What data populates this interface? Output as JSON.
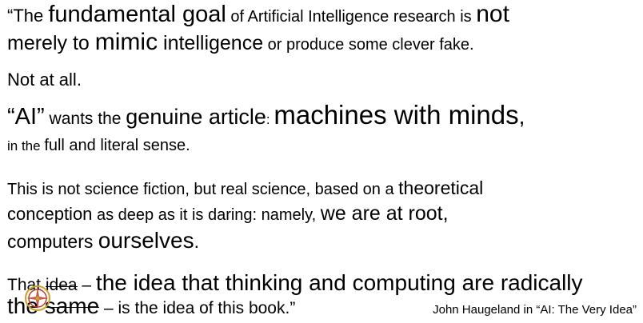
{
  "quote": {
    "l1": {
      "a": "“The ",
      "b": "fundamental goal",
      "c": " of Artificial Intelligence research is ",
      "d": "not"
    },
    "l2": {
      "a": "merely to ",
      "b": "mimic",
      "c": " intelligence",
      "d": " or produce some clever fake."
    },
    "l3": "Not at all.",
    "l4": {
      "a": "“AI”",
      "b": " wants the ",
      "c": "genuine article",
      "d": ": ",
      "e": "machines with minds",
      "f": ","
    },
    "l5": {
      "a": "in the ",
      "b": "full and literal sense",
      "c": "."
    },
    "l6": {
      "a": "This is not science fiction, but real science, based on a ",
      "b": "theoretical"
    },
    "l7": {
      "a": "conception",
      "b": " as deep as it is daring: namely, ",
      "c": "we are at root,"
    },
    "l8": {
      "a": "computers ",
      "b": "ourselves",
      "c": "."
    },
    "l9": {
      "a": "That ",
      "b": "idea",
      "c": " – ",
      "d": "the idea that thinking and computing are radically"
    },
    "l10": {
      "a": "the ",
      "b": "same",
      "c": " – is the idea of this book.”"
    }
  },
  "attribution": "John Haugeland in “AI: The Very Idea”",
  "colors": {
    "text": "#000000",
    "seal_red": "#c0392b",
    "seal_gold": "#c9a227"
  },
  "icons": {
    "seal": "compass-seal-icon"
  }
}
